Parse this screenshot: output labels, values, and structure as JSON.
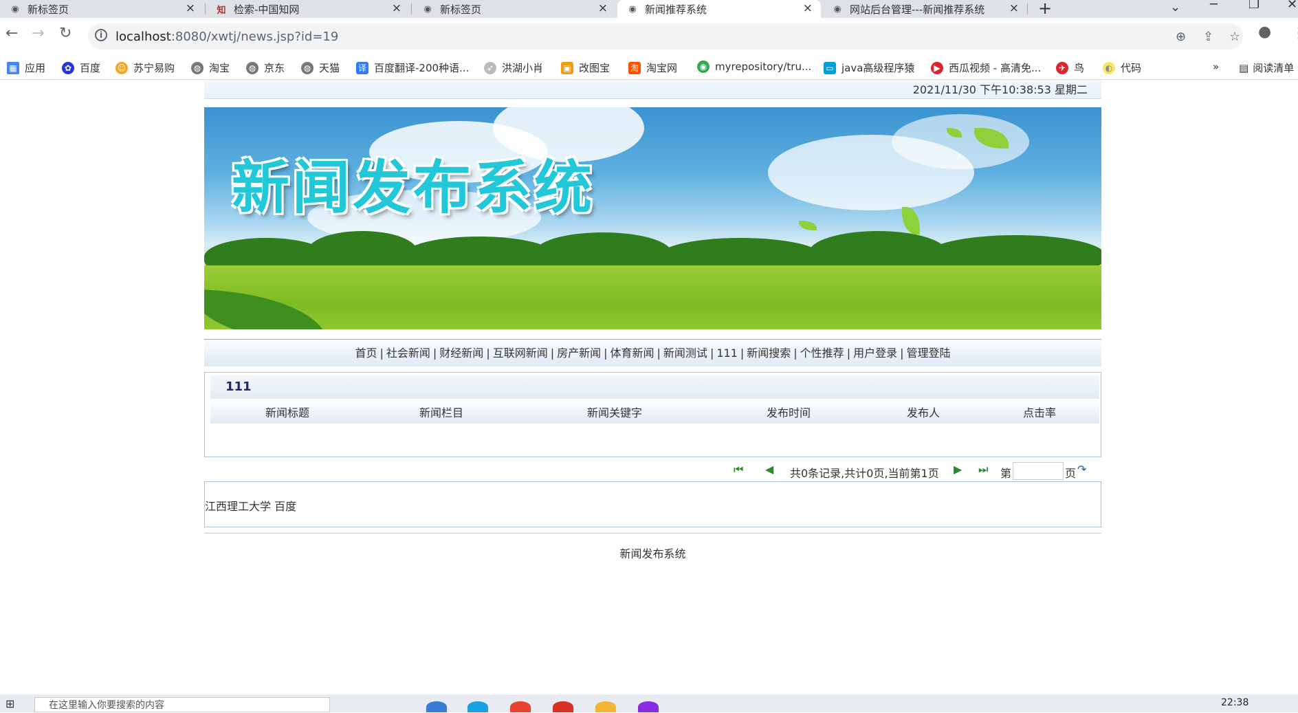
{
  "browser": {
    "tabs": [
      {
        "title": "新标签页",
        "active": false
      },
      {
        "title": "检索-中国知网",
        "active": false
      },
      {
        "title": "新标签页",
        "active": false
      },
      {
        "title": "新闻推荐系统",
        "active": true
      },
      {
        "title": "网站后台管理---新闻推荐系统",
        "active": false
      }
    ],
    "new_tab": "+",
    "url_host": "localhost",
    "url_rest": ":8080/xwtj/news.jsp?id=19",
    "bookmarks": [
      {
        "label": "应用",
        "icon": "apps-grid-icon",
        "color": "#4285f4"
      },
      {
        "label": "百度",
        "icon": "baidu-paw-icon",
        "color": "#2932e1"
      },
      {
        "label": "苏宁易购",
        "icon": "suning-icon",
        "color": "#f5a623"
      },
      {
        "label": "淘宝",
        "icon": "globe-icon",
        "color": "#777777"
      },
      {
        "label": "京东",
        "icon": "globe-icon",
        "color": "#777777"
      },
      {
        "label": "天猫",
        "icon": "globe-icon",
        "color": "#777777"
      },
      {
        "label": "百度翻译-200种语...",
        "icon": "translate-icon",
        "color": "#2e7cf6"
      },
      {
        "label": "洪湖小肖",
        "icon": "bird-icon",
        "color": "#999999"
      },
      {
        "label": "改图宝",
        "icon": "gaitubao-icon",
        "color": "#f39c12"
      },
      {
        "label": "淘宝网",
        "icon": "taobao-icon",
        "color": "#ff5000"
      },
      {
        "label": "myrepository/tru...",
        "icon": "chrome-icon",
        "color": "#34a853"
      },
      {
        "label": "java高级程序猿",
        "icon": "bilibili-icon",
        "color": "#00a1d6"
      },
      {
        "label": "西瓜视频 - 高清免...",
        "icon": "xigua-icon",
        "color": "#e0242b"
      },
      {
        "label": "鸟",
        "icon": "bird-red-icon",
        "color": "#e0242b"
      },
      {
        "label": "代码",
        "icon": "code-icon",
        "color": "#f5e663"
      }
    ],
    "bookmarks_more": "»",
    "reading_list": "阅读清单"
  },
  "page": {
    "datetime": "2021/11/30 下午10:38:53  星期二",
    "banner_title": "新闻发布系统",
    "menu": [
      "首页",
      "社会新闻",
      "财经新闻",
      "互联网新闻",
      "房产新闻",
      "体育新闻",
      "新闻测试",
      "111",
      "新闻搜索",
      "个性推荐",
      "用户登录",
      "管理登陆"
    ],
    "section_title": "111",
    "columns": [
      "新闻标题",
      "新闻栏目",
      "新闻关键字",
      "发布时间",
      "发布人",
      "点击率"
    ],
    "rows": [],
    "pager_text": "共0条记录,共计0页,当前第1页",
    "goto_prefix": "第",
    "goto_suffix": "页",
    "goto_value": "",
    "links_text": "江西理工大学 百度",
    "footer": "新闻发布系统"
  },
  "taskbar": {
    "search_placeholder": "在这里输入你要搜索的内容",
    "time": "22:38"
  },
  "colors": {
    "chrome_bg": "#dee1e6",
    "banner_title": "#22c7d8",
    "section_title": "#1a2a6a",
    "pager_icon": "#2e8a2e",
    "border": "#a8c4db"
  }
}
